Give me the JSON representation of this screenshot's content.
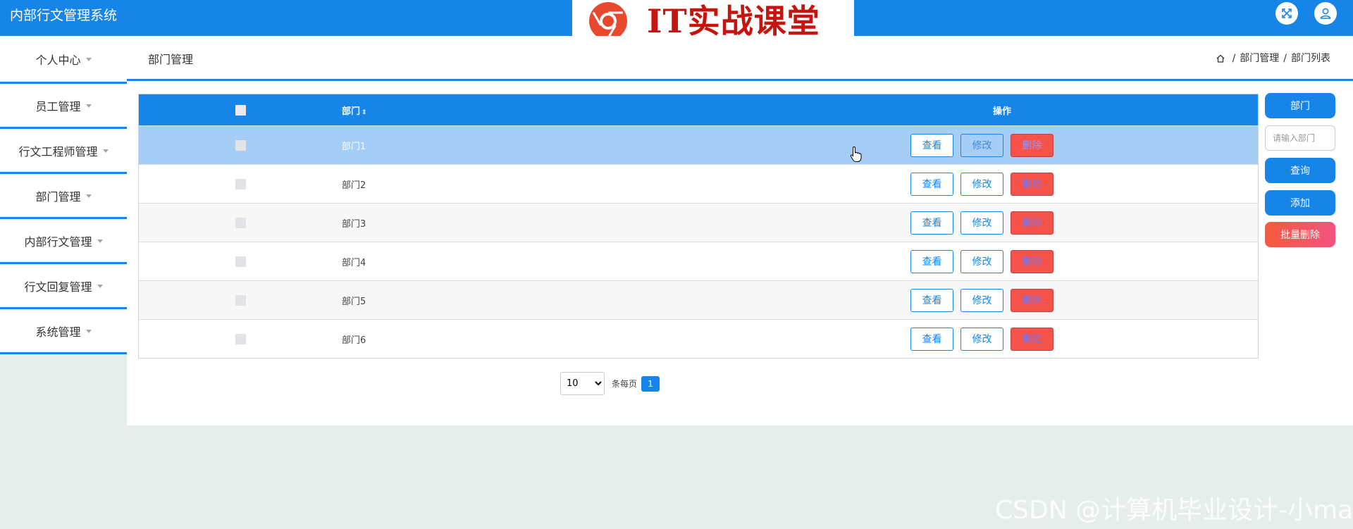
{
  "header": {
    "app_title": "内部行文管理系统",
    "logo_text": "IT实战课堂",
    "icons": [
      "fullscreen-icon",
      "user-icon"
    ]
  },
  "sidebar": {
    "items": [
      {
        "label": "个人中心"
      },
      {
        "label": "员工管理"
      },
      {
        "label": "行文工程师管理"
      },
      {
        "label": "部门管理"
      },
      {
        "label": "内部行文管理"
      },
      {
        "label": "行文回复管理"
      },
      {
        "label": "系统管理"
      }
    ]
  },
  "topbar": {
    "page_title": "部门管理",
    "breadcrumb": [
      "部门管理",
      "部门列表"
    ]
  },
  "table": {
    "header": {
      "name": "部门",
      "sort": "⇕",
      "ops": "操作"
    },
    "buttons": {
      "view": "查看",
      "edit": "修改",
      "delete": "删除"
    },
    "rows": [
      {
        "name": "部门1"
      },
      {
        "name": "部门2"
      },
      {
        "name": "部门3"
      },
      {
        "name": "部门4"
      },
      {
        "name": "部门5"
      },
      {
        "name": "部门6"
      }
    ]
  },
  "pager": {
    "page_size": "10",
    "per_page_label": "条每页",
    "current_page": "1"
  },
  "right_panel": {
    "field_label": "部门",
    "search_placeholder": "请输入部门",
    "query": "查询",
    "add": "添加",
    "batch_delete": "批量删除"
  },
  "watermark": "CSDN @计算机毕业设计-小ma",
  "colors": {
    "primary": "#1785e8",
    "danger": "#f5524a",
    "highlight_row": "#a5cdf5"
  }
}
